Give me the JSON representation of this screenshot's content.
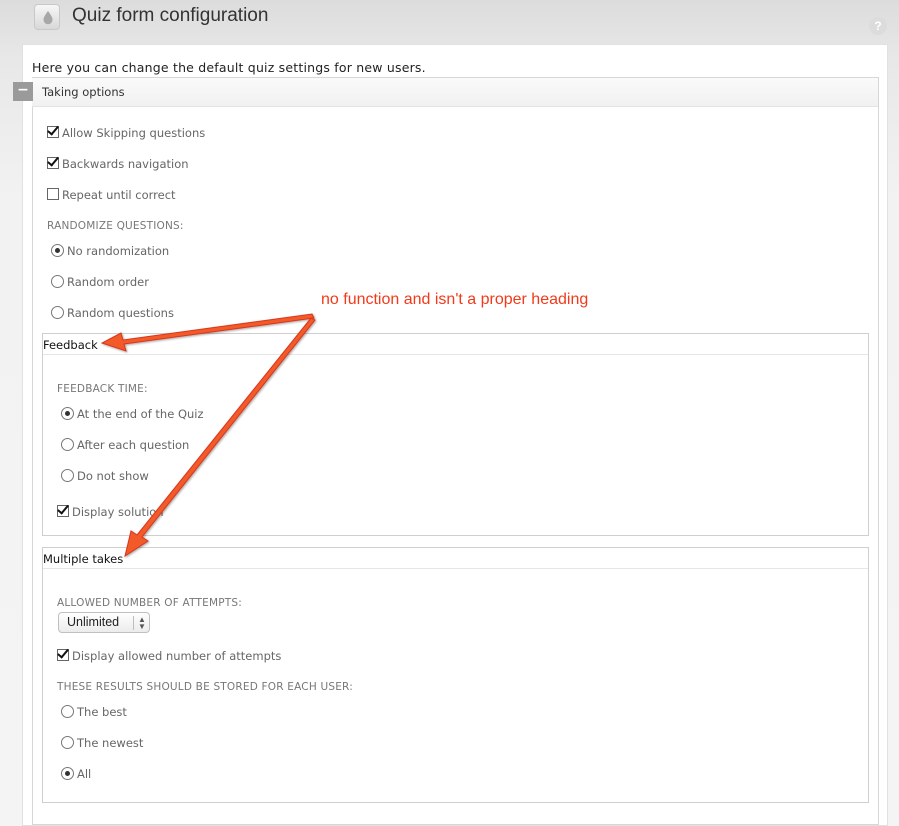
{
  "header": {
    "title": "Quiz form configuration",
    "help": "?"
  },
  "intro": "Here you can change the default quiz settings for new users.",
  "taking_options": {
    "collapse": "−",
    "legend": "Taking options",
    "allow_skipping": {
      "label": "Allow Skipping questions",
      "checked": true
    },
    "backwards_nav": {
      "label": "Backwards navigation",
      "checked": true
    },
    "repeat_until_correct": {
      "label": "Repeat until correct",
      "checked": false
    },
    "randomize_label": "RANDOMIZE QUESTIONS:",
    "randomize_options": [
      {
        "label": "No randomization",
        "selected": true
      },
      {
        "label": "Random order",
        "selected": false
      },
      {
        "label": "Random questions",
        "selected": false
      }
    ]
  },
  "feedback": {
    "legend": "Feedback",
    "time_label": "FEEDBACK TIME:",
    "time_options": [
      {
        "label": "At the end of the Quiz",
        "selected": true
      },
      {
        "label": "After each question",
        "selected": false
      },
      {
        "label": "Do not show",
        "selected": false
      }
    ],
    "display_solution": {
      "label": "Display solution",
      "checked": true
    }
  },
  "multiple_takes": {
    "legend": "Multiple takes",
    "attempts_label": "ALLOWED NUMBER OF ATTEMPTS:",
    "attempts_value": "Unlimited",
    "display_allowed": {
      "label": "Display allowed number of attempts",
      "checked": true
    },
    "store_label": "THESE RESULTS SHOULD BE STORED FOR EACH USER:",
    "store_options": [
      {
        "label": "The best",
        "selected": false
      },
      {
        "label": "The newest",
        "selected": false
      },
      {
        "label": "All",
        "selected": true
      }
    ]
  },
  "annotation": "no function and isn't a proper heading",
  "colors": {
    "annotation": "#f23a1a",
    "arrow_fill": "#f25a2a"
  }
}
